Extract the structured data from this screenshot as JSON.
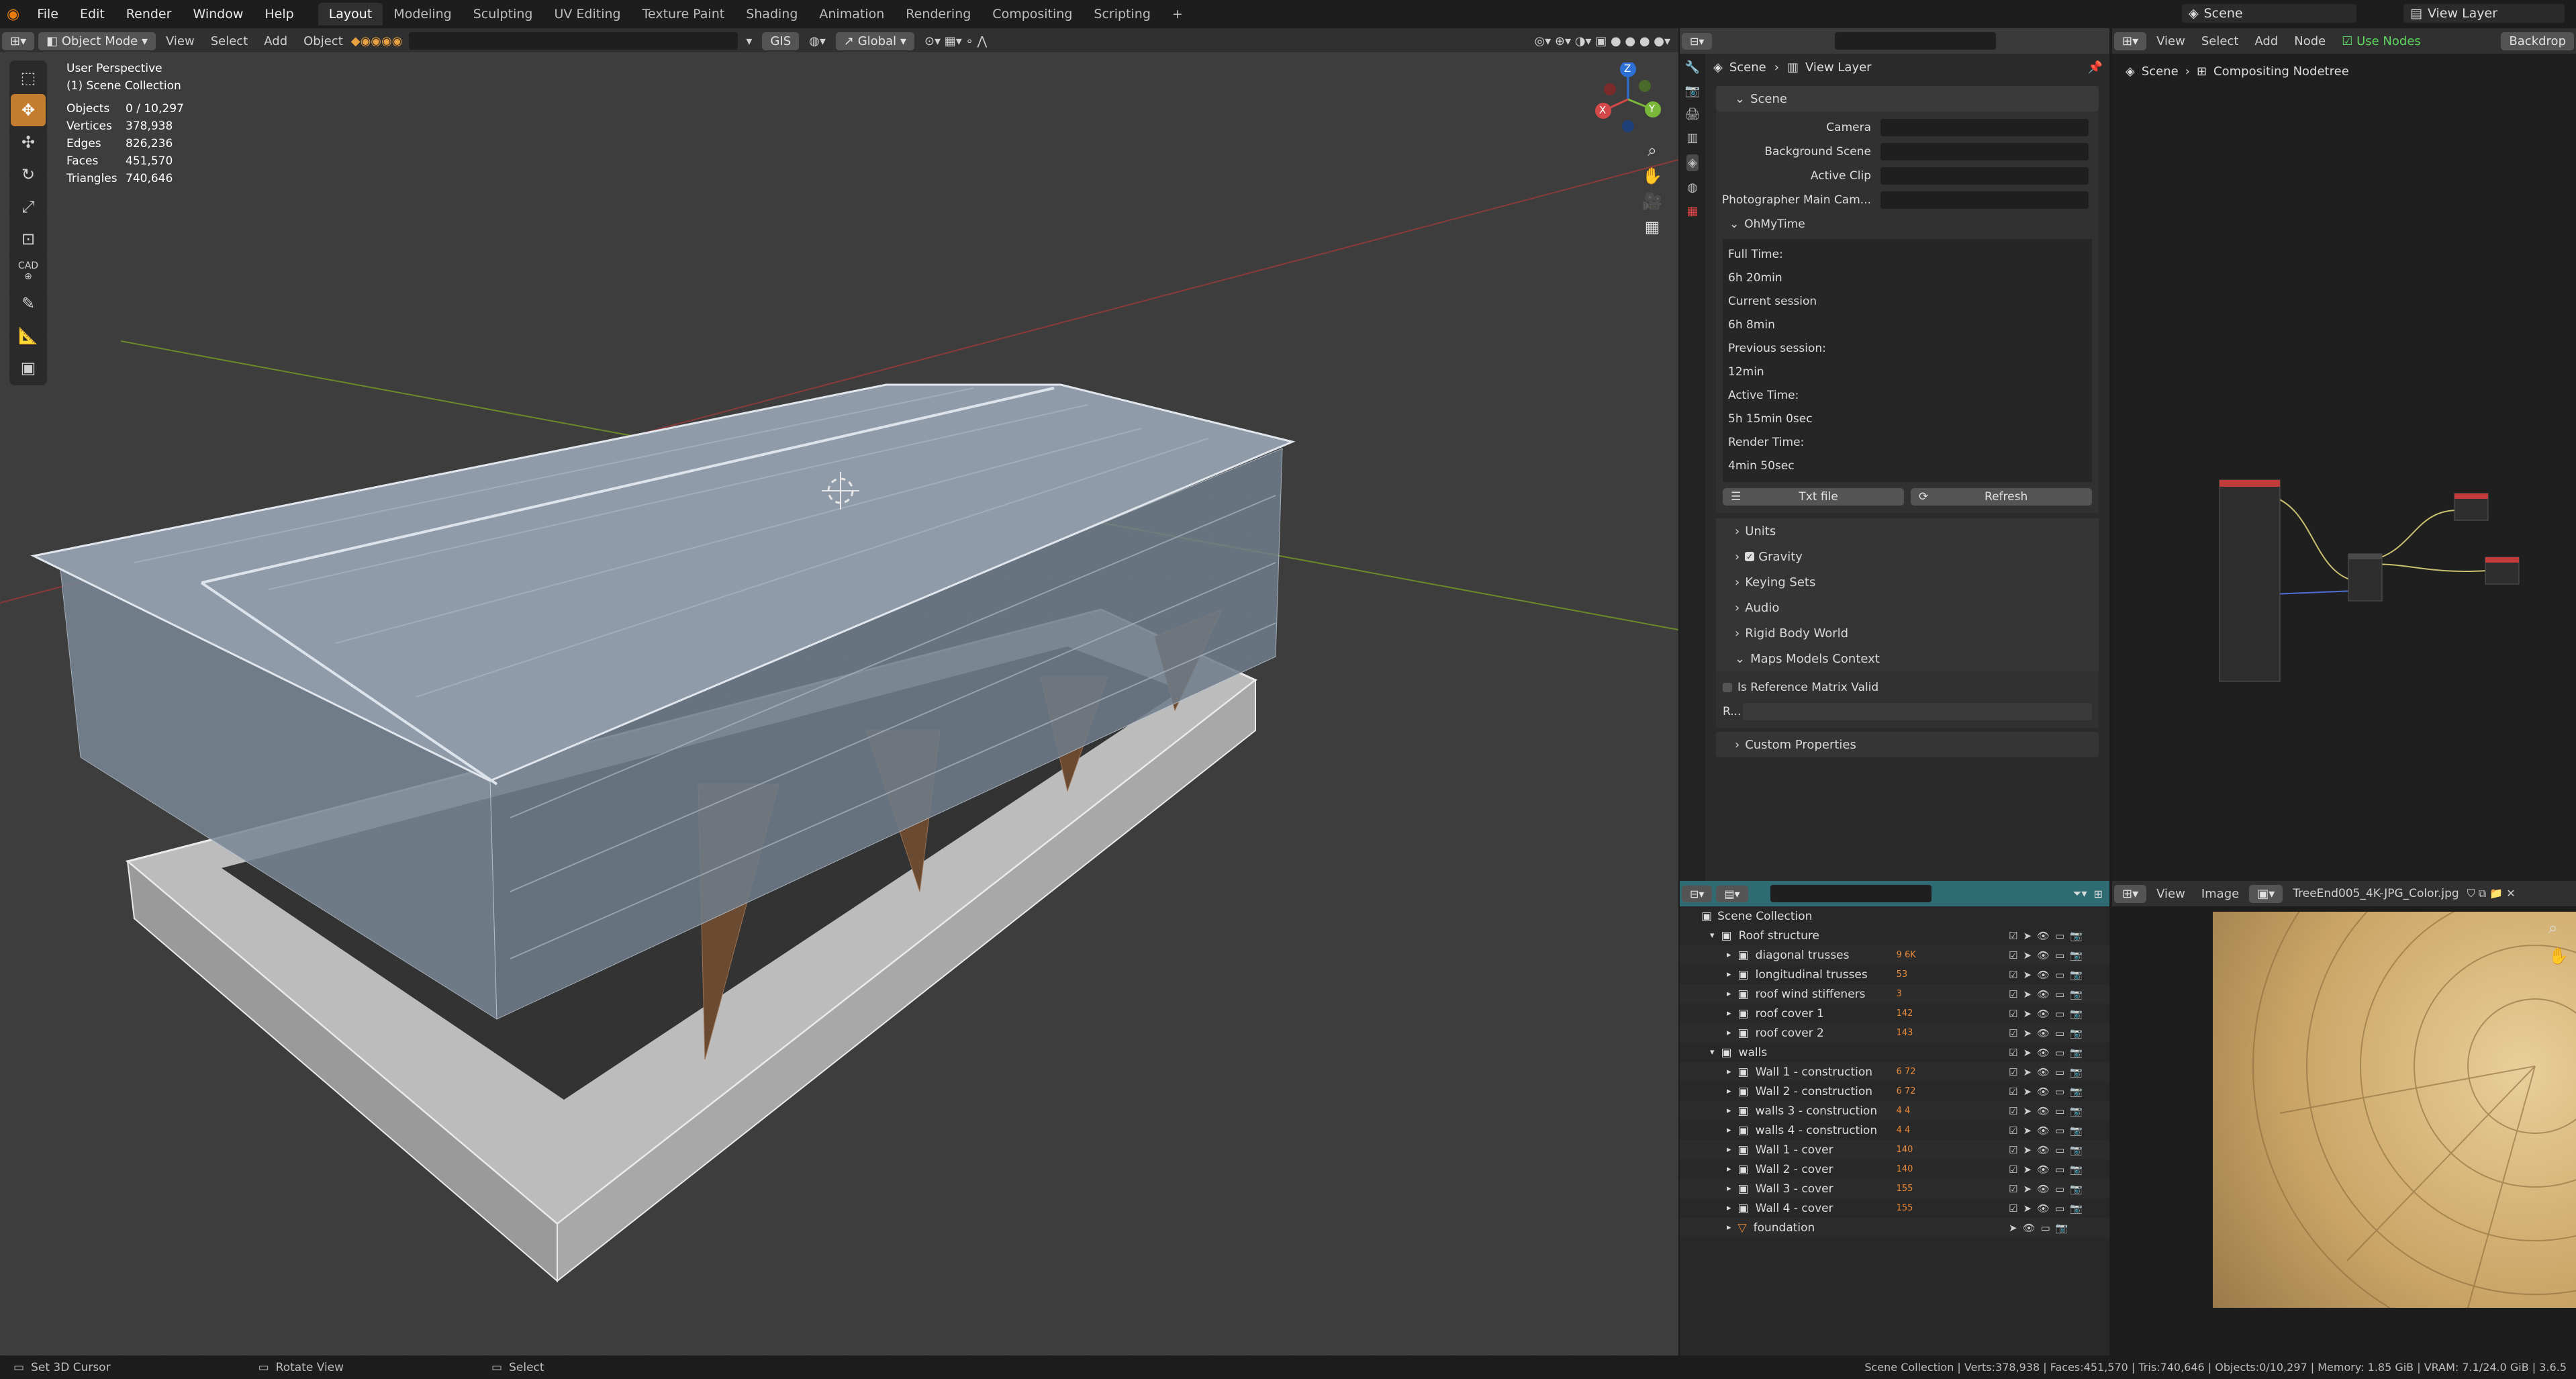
{
  "topbar": {
    "menus": [
      "File",
      "Edit",
      "Render",
      "Window",
      "Help"
    ],
    "workspaces": [
      "Layout",
      "Modeling",
      "Sculpting",
      "UV Editing",
      "Texture Paint",
      "Shading",
      "Animation",
      "Rendering",
      "Compositing",
      "Scripting"
    ],
    "active_workspace": "Layout",
    "scene": "Scene",
    "view_layer": "View Layer"
  },
  "viewport": {
    "mode": "Object Mode",
    "menus": [
      "View",
      "Select",
      "Add",
      "Object"
    ],
    "gis": "GIS",
    "orientation": "Global",
    "perspective": "User Perspective",
    "collection": "(1) Scene Collection",
    "stats": [
      {
        "label": "Objects",
        "value": "0 / 10,297"
      },
      {
        "label": "Vertices",
        "value": "378,938"
      },
      {
        "label": "Edges",
        "value": "826,236"
      },
      {
        "label": "Faces",
        "value": "451,570"
      },
      {
        "label": "Triangles",
        "value": "740,646"
      }
    ],
    "cad_label": "CAD",
    "gizmo": {
      "x": "X",
      "y": "Y",
      "z": "Z"
    }
  },
  "properties": {
    "breadcrumb": [
      "Scene",
      "View Layer"
    ],
    "scene_section": "Scene",
    "fields": [
      "Camera",
      "Background Scene",
      "Active Clip",
      "Photographer Main Cam..."
    ],
    "ohmytime": {
      "title": "OhMyTime",
      "lines": [
        "Full Time:",
        "6h  20min",
        "Current session",
        "6h  8min",
        "Previous session:",
        "12min",
        "Active Time:",
        "5h  15min  0sec",
        "Render Time:",
        "4min  50sec"
      ],
      "txt_button": "Txt file",
      "refresh_button": "Refresh"
    },
    "sections": [
      "Units",
      "Gravity",
      "Keying Sets",
      "Audio",
      "Rigid Body World",
      "Maps Models Context"
    ],
    "checkbox_label": "Is Reference Matrix Valid",
    "r_label": "R...",
    "custom": "Custom Properties"
  },
  "node_editor": {
    "menus": [
      "View",
      "Select",
      "Add",
      "Node"
    ],
    "use_nodes": "Use Nodes",
    "backdrop": "Backdrop",
    "breadcrumb": [
      "Scene",
      "Compositing Nodetree"
    ]
  },
  "outliner": {
    "root": "Scene Collection",
    "items": [
      {
        "name": "Roof structure",
        "level": 0,
        "badge": ""
      },
      {
        "name": "diagonal trusses",
        "level": 1,
        "badge": "9  6K"
      },
      {
        "name": "longitudinal trusses",
        "level": 1,
        "badge": "53"
      },
      {
        "name": "roof wind stiffeners",
        "level": 1,
        "badge": "3"
      },
      {
        "name": "roof cover 1",
        "level": 1,
        "badge": "142"
      },
      {
        "name": "roof cover 2",
        "level": 1,
        "badge": "143"
      },
      {
        "name": "walls",
        "level": 0,
        "badge": ""
      },
      {
        "name": "Wall 1 - construction",
        "level": 1,
        "badge": "6  72"
      },
      {
        "name": "Wall 2 - construction",
        "level": 1,
        "badge": "6  72"
      },
      {
        "name": "walls 3 - construction",
        "level": 1,
        "badge": "4  4"
      },
      {
        "name": "walls 4 - construction",
        "level": 1,
        "badge": "4  4"
      },
      {
        "name": "Wall 1 - cover",
        "level": 1,
        "badge": "140"
      },
      {
        "name": "Wall 2 - cover",
        "level": 1,
        "badge": "140"
      },
      {
        "name": "Wall 3 - cover",
        "level": 1,
        "badge": "155"
      },
      {
        "name": "Wall 4 - cover",
        "level": 1,
        "badge": "155"
      },
      {
        "name": "foundation",
        "level": 1,
        "badge": ""
      }
    ]
  },
  "image_editor": {
    "menus": [
      "View",
      "Image"
    ],
    "image_name": "TreeEnd005_4K-JPG_Color.jpg"
  },
  "statusbar": {
    "left": [
      "Set 3D Cursor",
      "Rotate View",
      "Select"
    ],
    "right": "Scene Collection | Verts:378,938 | Faces:451,570 | Tris:740,646 | Objects:0/10,297 | Memory: 1.85 GiB | VRAM: 7.1/24.0 GiB | 3.6.5"
  }
}
